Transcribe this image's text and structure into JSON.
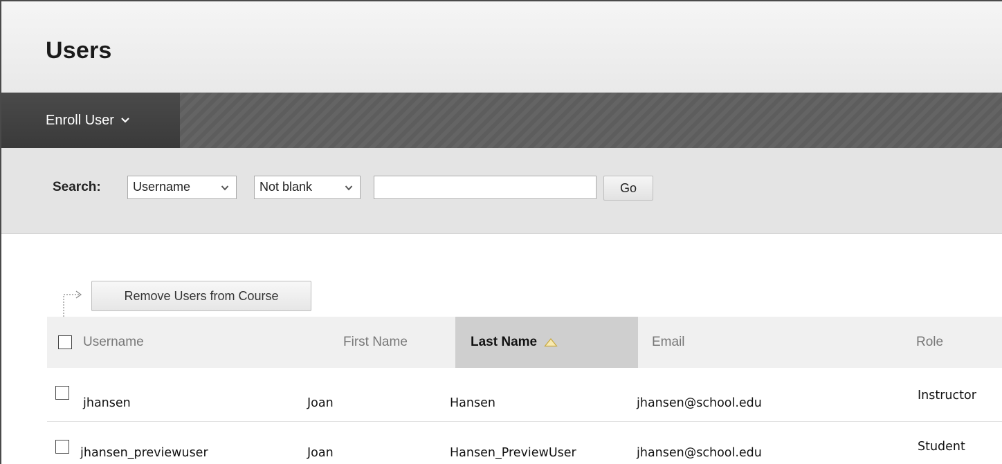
{
  "page": {
    "title": "Users"
  },
  "actionbar": {
    "enroll_label": "Enroll User"
  },
  "search": {
    "label": "Search:",
    "field_selected": "Username",
    "operator_selected": "Not blank",
    "query_value": "",
    "go_label": "Go"
  },
  "bulk": {
    "remove_label": "Remove Users from Course"
  },
  "table": {
    "headers": {
      "username": "Username",
      "first_name": "First Name",
      "last_name": "Last Name",
      "email": "Email",
      "role": "Role"
    },
    "sorted_by": "Last Name",
    "sort_direction": "ascending",
    "rows": [
      {
        "username": "jhansen",
        "first_name": "Joan",
        "last_name": "Hansen",
        "email": "jhansen@school.edu",
        "role": "Instructor"
      },
      {
        "username": "jhansen_previewuser",
        "first_name": "Joan",
        "last_name": "Hansen_PreviewUser",
        "email": "jhansen@school.edu",
        "role": "Student"
      }
    ]
  },
  "colors": {
    "header_bg": "#efefef",
    "actionbar_bg": "#5d5d5d",
    "enroll_button_bg": "#3f3f3f",
    "searchbar_bg": "#e4e4e4",
    "sorted_header_bg": "#cfcfcf"
  },
  "icons": {
    "enroll_dropdown": "chevron-down-icon",
    "select_dropdown": "chevron-down-icon",
    "sort": "sort-ascending-triangle-icon",
    "bulk_action": "bulk-action-arrow-icon"
  }
}
